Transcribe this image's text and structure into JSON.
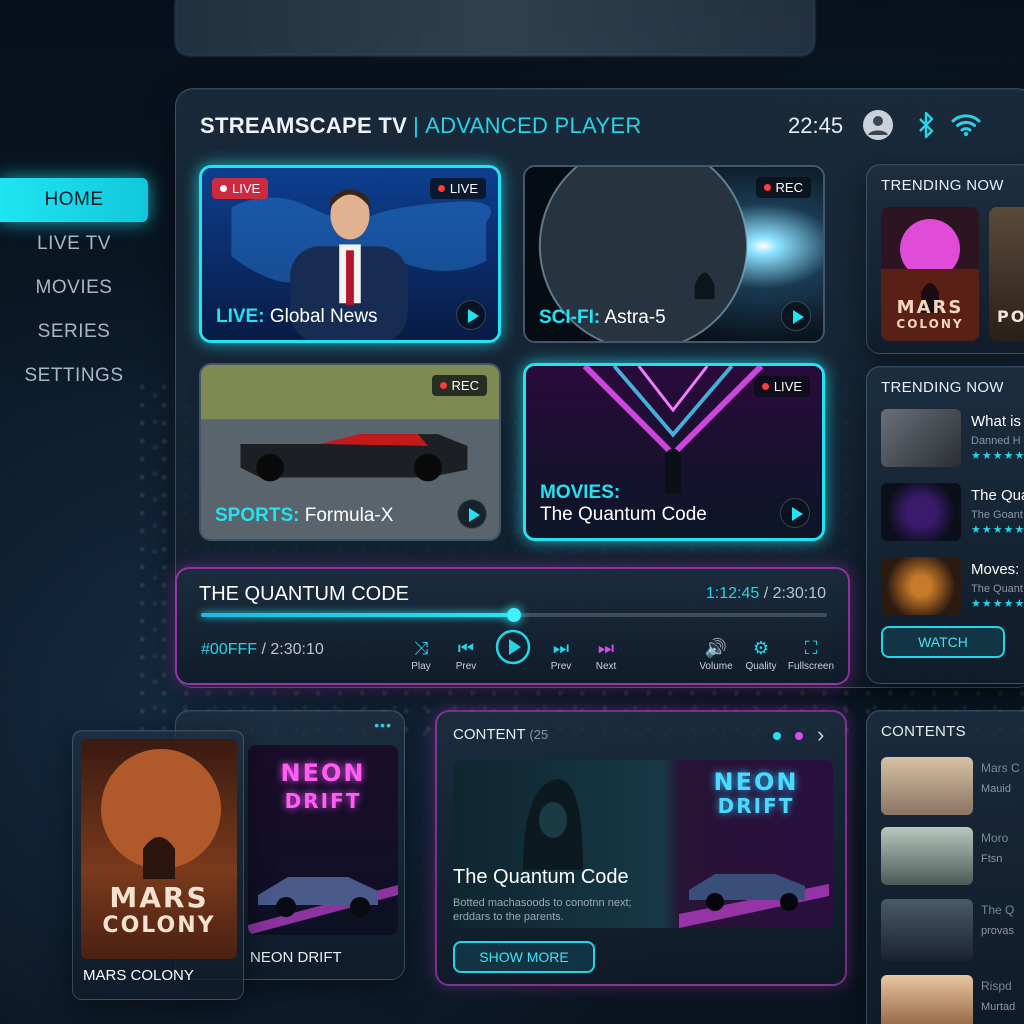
{
  "app": {
    "brand": "STREAMSCAPE TV",
    "separator": "|",
    "subtitle": "ADVANCED PLAYER",
    "clock": "22:45"
  },
  "sidebar": {
    "items": [
      {
        "label": "HOME",
        "active": true
      },
      {
        "label": "LIVE TV",
        "active": false
      },
      {
        "label": "MOVIES",
        "active": false
      },
      {
        "label": "SERIES",
        "active": false
      },
      {
        "label": "SETTINGS",
        "active": false
      }
    ]
  },
  "tiles": [
    {
      "category": "LIVE:",
      "title": "Global News",
      "badge_left": "LIVE",
      "badge_right": "LIVE"
    },
    {
      "category": "SCI-FI:",
      "title": "Astra-5",
      "badge_right": "REC"
    },
    {
      "category": "SPORTS:",
      "title": "Formula-X",
      "badge_right": "REC"
    },
    {
      "category": "MOVIES:",
      "title": "The Quantum Code",
      "badge_right": "LIVE"
    }
  ],
  "player": {
    "title": "THE QUANTUM CODE",
    "current_time": "1:12:45",
    "time_separator": "/",
    "total_time": "2:30:10",
    "hex_label": "#00FFF",
    "hex_separator": "/",
    "hex_time": "2:30:10",
    "progress": 0.5,
    "controls": [
      {
        "label": "Play",
        "icon": "shuffle-icon",
        "glyph": "⤨"
      },
      {
        "label": "Prev",
        "icon": "skip-back-icon",
        "glyph": "⏮"
      },
      {
        "label": "",
        "icon": "play-circle-icon",
        "glyph": "▶"
      },
      {
        "label": "Prev",
        "icon": "skip-forward-icon",
        "glyph": "⏭"
      },
      {
        "label": "Next",
        "icon": "next-icon",
        "glyph": "⏭"
      },
      {
        "label": "Volume",
        "icon": "volume-icon",
        "glyph": "🔊"
      },
      {
        "label": "Quality",
        "icon": "gear-icon",
        "glyph": "⚙"
      },
      {
        "label": "Fullscreen",
        "icon": "fullscreen-icon",
        "glyph": "⛶"
      }
    ]
  },
  "trending_top": {
    "heading": "TRENDING NOW",
    "cards": [
      {
        "title_line1": "MARS",
        "title_line2": "COLONY"
      },
      {
        "title_line1": "PO"
      }
    ]
  },
  "trending_list": {
    "heading": "TRENDING NOW",
    "items": [
      {
        "title": "What is",
        "subtitle": "Danned H",
        "stars": "★★★★★"
      },
      {
        "title": "The Qua",
        "subtitle": "The Goant",
        "stars": "★★★★★"
      },
      {
        "title": "Moves:",
        "subtitle": "The Quant",
        "stars": "★★★★★"
      }
    ],
    "watch_label": "WATCH"
  },
  "bottom_cards": {
    "more": "•••",
    "mars": {
      "line1": "MARS",
      "line2": "COLONY",
      "caption": "MARS COLONY"
    },
    "neon": {
      "line1": "NEON",
      "line2": "DRIFT",
      "caption": "NEON DRIFT"
    }
  },
  "content_panel": {
    "heading": "CONTENT",
    "count": "(25",
    "feature_title": "The Quantum Code",
    "feature_desc": "Botted machasoods to conotnn next; erddars to the parents.",
    "show_more": "SHOW MORE",
    "neon_line1": "NEON",
    "neon_line2": "DRIFT",
    "arrow": "›"
  },
  "contents_panel": {
    "heading": "CONTENTS",
    "items": [
      {
        "title": "Mars C",
        "subtitle": "Mauid"
      },
      {
        "title": "Moro",
        "subtitle": "Ftsn"
      },
      {
        "title": "The Q",
        "subtitle": "provas"
      },
      {
        "title": "Rispd",
        "subtitle": "Murtad"
      }
    ]
  },
  "colors": {
    "accent_cyan": "#22e3f2",
    "accent_magenta": "#e04bf0",
    "live_red": "#ff3b3b"
  }
}
